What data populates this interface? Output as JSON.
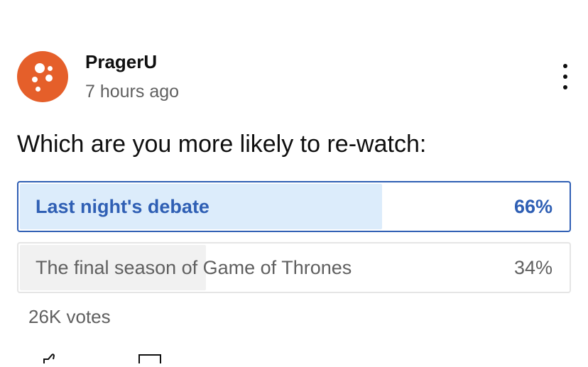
{
  "post": {
    "channel_name": "PragerU",
    "time": "7 hours ago",
    "avatar_color": "#e55f2a",
    "menu_icon": "more-vertical-icon"
  },
  "poll": {
    "question": "Which are you more likely to re-watch:",
    "options": [
      {
        "label": "Last night's debate",
        "percent_text": "66%",
        "percent": 66,
        "selected": true
      },
      {
        "label": "The final season of Game of Thrones",
        "percent_text": "34%",
        "percent": 34,
        "selected": false
      }
    ],
    "votes": "26K votes",
    "selected_color": "#2f5fb4",
    "selected_fill_color": "#dcecfb",
    "unselected_fill_color": "#f1f1f1"
  },
  "actions": {
    "icons": [
      "thumbs-up-icon",
      "comment-icon"
    ]
  }
}
